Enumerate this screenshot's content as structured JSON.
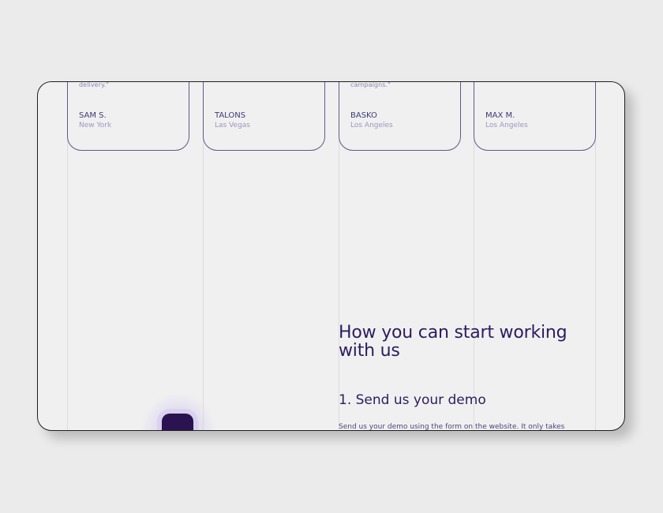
{
  "testimonials": [
    {
      "quote": "delivery.\"",
      "name": "SAM S.",
      "city": "New York"
    },
    {
      "quote": "",
      "name": "TALONS",
      "city": "Las Vegas"
    },
    {
      "quote": "campaigns.\"",
      "name": "BASKO",
      "city": "Los Angeles"
    },
    {
      "quote": "",
      "name": "MAX M.",
      "city": "Los Angeles"
    }
  ],
  "section": {
    "heading_line1": "How you can start working",
    "heading_line2": "with us",
    "step1_title": "1. Send us your demo",
    "step1_text": "Send us your demo using the form on the website. It only takes"
  },
  "colors": {
    "accent": "#2b1d5e",
    "card_border": "#5e5a8c",
    "chat_button": "#2a1350"
  },
  "icons": {
    "chat": "chat-bubble-icon"
  }
}
